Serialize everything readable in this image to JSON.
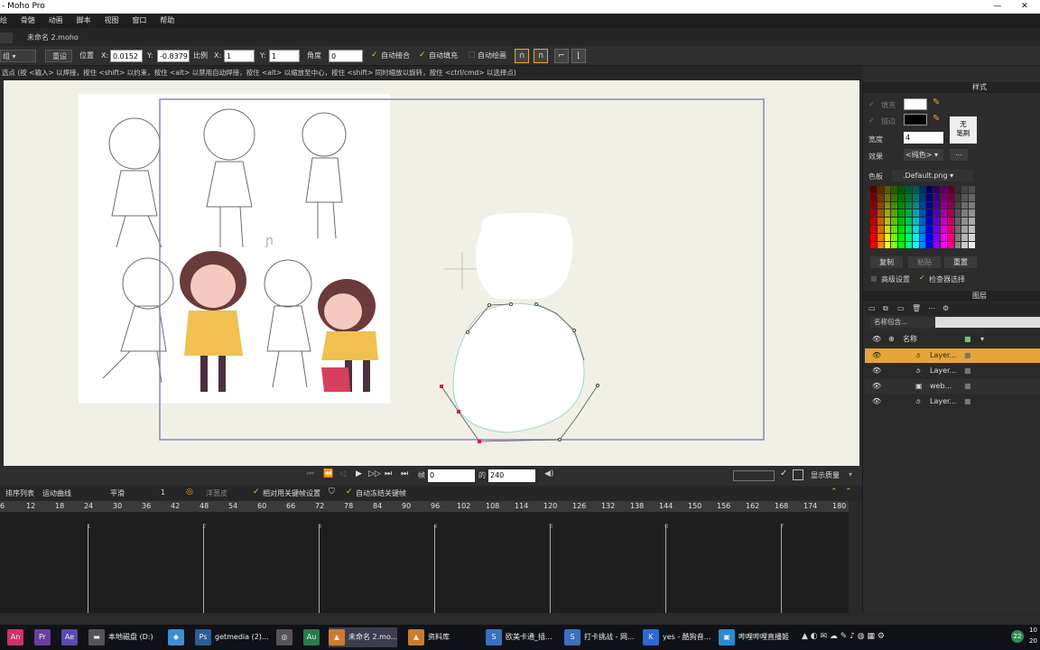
{
  "window": {
    "title": "- Moho Pro"
  },
  "menu": [
    "绘",
    "骨骼",
    "动画",
    "脚本",
    "视图",
    "窗口",
    "帮助"
  ],
  "doc_tab": "未命名 2.moho",
  "tool_options": {
    "dropdown_value": "组",
    "reset_label": "重设",
    "position_label": "位置",
    "x_label": "X:",
    "x_value": "0.0152",
    "y_label": "Y:",
    "y_value": "-0.8379",
    "scale_label": "比例",
    "scale_x_label": "X:",
    "scale_x_value": "1",
    "scale_y_label": "Y:",
    "scale_y_value": "1",
    "angle_label": "角度",
    "angle_value": "0",
    "auto_weld": "自动接合",
    "auto_fill": "自动填充",
    "auto_stroke": "自动绘画"
  },
  "hint": "选点 (按 <输入> 以焊接，按住 <shift> 以约束，按住 <alt> 以禁用自动焊接，按住 <alt> 以缩放至中心，按住 <shift> 同时缩放以旋转，按住 <ctrl/cmd> 以选择点)",
  "playback": {
    "frame_label": "帧",
    "frame_value": "0",
    "of_label": "的",
    "total_value": "240",
    "quality": "显示质量"
  },
  "timeline_opts": {
    "tab1": "排序列表",
    "tab2": "运动曲线",
    "interp": "平滑",
    "interp_val": "1",
    "onion": "洋葱皮",
    "relative_keys": "相对用关键帧设置",
    "auto_freeze": "自动冻结关键帧"
  },
  "ruler": [
    "6",
    "12",
    "18",
    "24",
    "30",
    "36",
    "42",
    "48",
    "54",
    "60",
    "66",
    "72",
    "78",
    "84",
    "90",
    "96",
    "102",
    "108",
    "114",
    "120",
    "126",
    "132",
    "138",
    "144",
    "150",
    "156",
    "162",
    "168",
    "174",
    "180"
  ],
  "keys": [
    "1",
    "2",
    "3",
    "4",
    "5",
    "6",
    "7"
  ],
  "style_panel": {
    "title": "样式",
    "fill": "填充",
    "stroke": "描边",
    "width_label": "宽度",
    "width_value": "4",
    "effect_label": "效果",
    "effect_value": "<纯色>",
    "none_btn": "无\n笔刷",
    "palette_label": "色板",
    "palette_value": ".Default.png",
    "copy": "复制",
    "paste": "粘贴",
    "reset": "重置",
    "advanced": "高级设置",
    "checker": "检查器选择"
  },
  "layers_panel": {
    "title": "图层",
    "search_placeholder": "名称包含...",
    "name_header": "名称",
    "layers": [
      {
        "name": "Layer...",
        "type": "vector",
        "selected": true
      },
      {
        "name": "Layer...",
        "type": "vector",
        "selected": false
      },
      {
        "name": "web...",
        "type": "image",
        "selected": false
      },
      {
        "name": "Layer...",
        "type": "vector",
        "selected": false
      }
    ]
  },
  "taskbar": [
    {
      "label": "",
      "icon": "An",
      "color": "#cc3366"
    },
    {
      "label": "",
      "icon": "Pr",
      "color": "#6a3fa0"
    },
    {
      "label": "",
      "icon": "Ae",
      "color": "#5a4ab0"
    },
    {
      "label": "本地磁盘 (D:)",
      "icon": "▬",
      "color": "#555"
    },
    {
      "label": "",
      "icon": "◆",
      "color": "#3b8ed6"
    },
    {
      "label": "getmedia (2)...",
      "icon": "Ps",
      "color": "#2a5d9a"
    },
    {
      "label": "",
      "icon": "◎",
      "color": "#555"
    },
    {
      "label": "",
      "icon": "Au",
      "color": "#2a7a4a"
    },
    {
      "label": "未命名 2.mo...",
      "icon": "▲",
      "color": "#d07a30"
    },
    {
      "label": "资料库",
      "icon": "▲",
      "color": "#d07a30"
    },
    {
      "label": "欧美卡通_插...",
      "icon": "S",
      "color": "#3a70c0"
    },
    {
      "label": "打卡挑战 - 网...",
      "icon": "S",
      "color": "#3a70c0"
    },
    {
      "label": "yes - 酷狗音...",
      "icon": "K",
      "color": "#2a6ad0"
    },
    {
      "label": "哔哩哔哩直播姬",
      "icon": "▣",
      "color": "#2a8ad0"
    }
  ],
  "clock": {
    "time": "10",
    "date": "20"
  },
  "colors": {
    "accent": "#e7a43a",
    "canvas": "#f1f0e6",
    "panel": "#2c2c2c",
    "frame_border": "#8a86b8"
  }
}
